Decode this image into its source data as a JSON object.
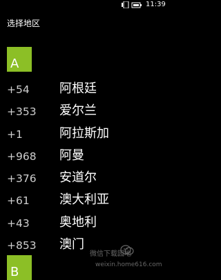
{
  "status_bar": {
    "time": "11:39",
    "icons": [
      "network-icon",
      "battery-icon"
    ]
  },
  "page": {
    "title": "选择地区"
  },
  "groups": [
    {
      "letter": "A"
    },
    {
      "letter": "B"
    }
  ],
  "countries": [
    {
      "code": "+54",
      "name": "阿根廷"
    },
    {
      "code": "+353",
      "name": "爱尔兰"
    },
    {
      "code": "+1",
      "name": "阿拉斯加"
    },
    {
      "code": "+968",
      "name": "阿曼"
    },
    {
      "code": "+376",
      "name": "安道尔"
    },
    {
      "code": "+61",
      "name": "澳大利亚"
    },
    {
      "code": "+43",
      "name": "奥地利"
    },
    {
      "code": "+853",
      "name": "澳门"
    }
  ],
  "watermark": {
    "text": "微信下载园地",
    "url": "weixin.home616.com"
  },
  "colors": {
    "background": "#000000",
    "accent": "#8cbf26",
    "code_text": "#cfcfcf",
    "name_text": "#ffffff"
  }
}
